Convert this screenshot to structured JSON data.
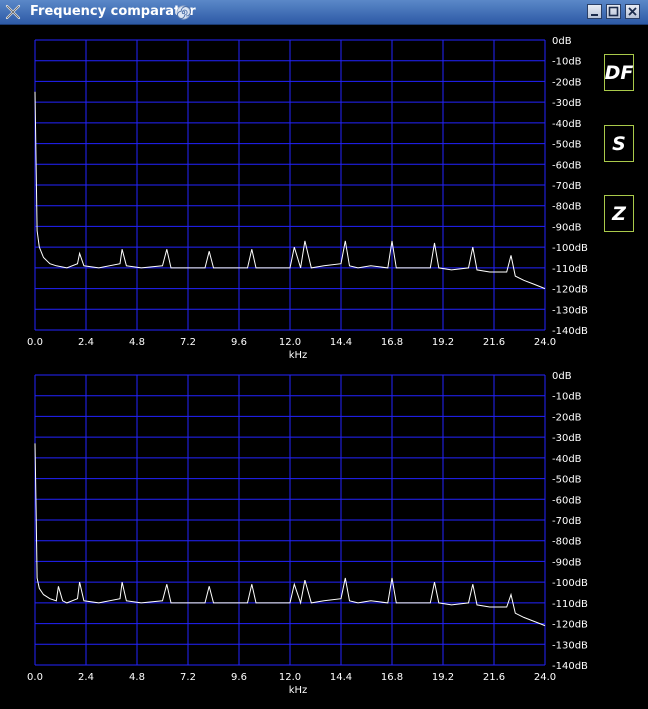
{
  "window": {
    "title": "Frequency comparator"
  },
  "controls": {
    "df_label": "DF",
    "s_label": "S",
    "z_label": "Z"
  },
  "axes": {
    "x_label": "kHz",
    "x_ticks": [
      "0.0",
      "2.4",
      "4.8",
      "7.2",
      "9.6",
      "12.0",
      "14.4",
      "16.8",
      "19.2",
      "21.6",
      "24.0"
    ],
    "y_ticks": [
      "0dB",
      "-10dB",
      "-20dB",
      "-30dB",
      "-40dB",
      "-50dB",
      "-60dB",
      "-70dB",
      "-80dB",
      "-90dB",
      "-100dB",
      "-110dB",
      "-120dB",
      "-130dB",
      "-140dB"
    ]
  },
  "colors": {
    "grid": "#2323ff",
    "trace": "#ffffff",
    "button_border": "#a9c94a",
    "background": "#000000"
  },
  "chart_data": [
    {
      "type": "line",
      "xlabel": "kHz",
      "ylabel": "",
      "xlim": [
        0,
        24.0
      ],
      "ylim": [
        -140,
        0
      ],
      "grid": true,
      "x_step": 2.4,
      "y_step": 10,
      "series": [
        {
          "x": [
            0.0,
            0.05,
            0.1,
            0.2,
            0.4,
            0.7,
            1.0,
            1.5,
            2.0,
            2.1,
            2.3,
            3.0,
            4.0,
            4.1,
            4.3,
            5.0,
            6.0,
            6.2,
            6.4,
            7.0,
            8.0,
            8.2,
            8.4,
            9.0,
            10.0,
            10.2,
            10.4,
            11.0,
            12.0,
            12.2,
            12.5,
            12.7,
            13.0,
            13.6,
            14.4,
            14.6,
            14.8,
            15.2,
            15.8,
            16.6,
            16.8,
            17.0,
            17.6,
            18.6,
            18.8,
            19.0,
            19.6,
            20.4,
            20.6,
            20.8,
            21.4,
            22.2,
            22.4,
            22.6,
            23.0,
            23.5,
            24.0
          ],
          "y": [
            -25,
            -60,
            -92,
            -100,
            -105,
            -108,
            -109,
            -110,
            -108,
            -103,
            -109,
            -110,
            -108,
            -101,
            -109,
            -110,
            -109,
            -101,
            -110,
            -110,
            -110,
            -102,
            -110,
            -110,
            -110,
            -101,
            -110,
            -110,
            -110,
            -100,
            -110,
            -97,
            -110,
            -109,
            -108,
            -97,
            -109,
            -110,
            -109,
            -110,
            -97,
            -110,
            -110,
            -110,
            -98,
            -110,
            -111,
            -110,
            -100,
            -111,
            -112,
            -112,
            -104,
            -114,
            -116,
            -118,
            -120
          ]
        }
      ]
    },
    {
      "type": "line",
      "xlabel": "kHz",
      "ylabel": "",
      "xlim": [
        0,
        24.0
      ],
      "ylim": [
        -140,
        0
      ],
      "grid": true,
      "x_step": 2.4,
      "y_step": 10,
      "series": [
        {
          "x": [
            0.0,
            0.05,
            0.1,
            0.2,
            0.4,
            0.7,
            1.0,
            1.1,
            1.3,
            1.5,
            2.0,
            2.1,
            2.3,
            3.0,
            4.0,
            4.1,
            4.3,
            5.0,
            6.0,
            6.2,
            6.4,
            7.0,
            8.0,
            8.2,
            8.4,
            9.0,
            10.0,
            10.2,
            10.4,
            11.0,
            12.0,
            12.2,
            12.5,
            12.7,
            13.0,
            13.6,
            14.4,
            14.6,
            14.8,
            15.2,
            15.8,
            16.6,
            16.8,
            17.0,
            17.6,
            18.6,
            18.8,
            19.0,
            19.6,
            20.4,
            20.6,
            20.8,
            21.4,
            22.2,
            22.4,
            22.6,
            23.0,
            23.5,
            24.0
          ],
          "y": [
            -33,
            -65,
            -98,
            -103,
            -106,
            -108,
            -109,
            -102,
            -109,
            -110,
            -108,
            -100,
            -109,
            -110,
            -108,
            -100,
            -109,
            -110,
            -109,
            -101,
            -110,
            -110,
            -110,
            -102,
            -110,
            -110,
            -110,
            -101,
            -110,
            -110,
            -110,
            -101,
            -110,
            -99,
            -110,
            -109,
            -108,
            -98,
            -109,
            -110,
            -109,
            -110,
            -98,
            -110,
            -110,
            -110,
            -100,
            -110,
            -111,
            -110,
            -101,
            -111,
            -112,
            -112,
            -106,
            -115,
            -117,
            -119,
            -121
          ]
        }
      ]
    }
  ]
}
